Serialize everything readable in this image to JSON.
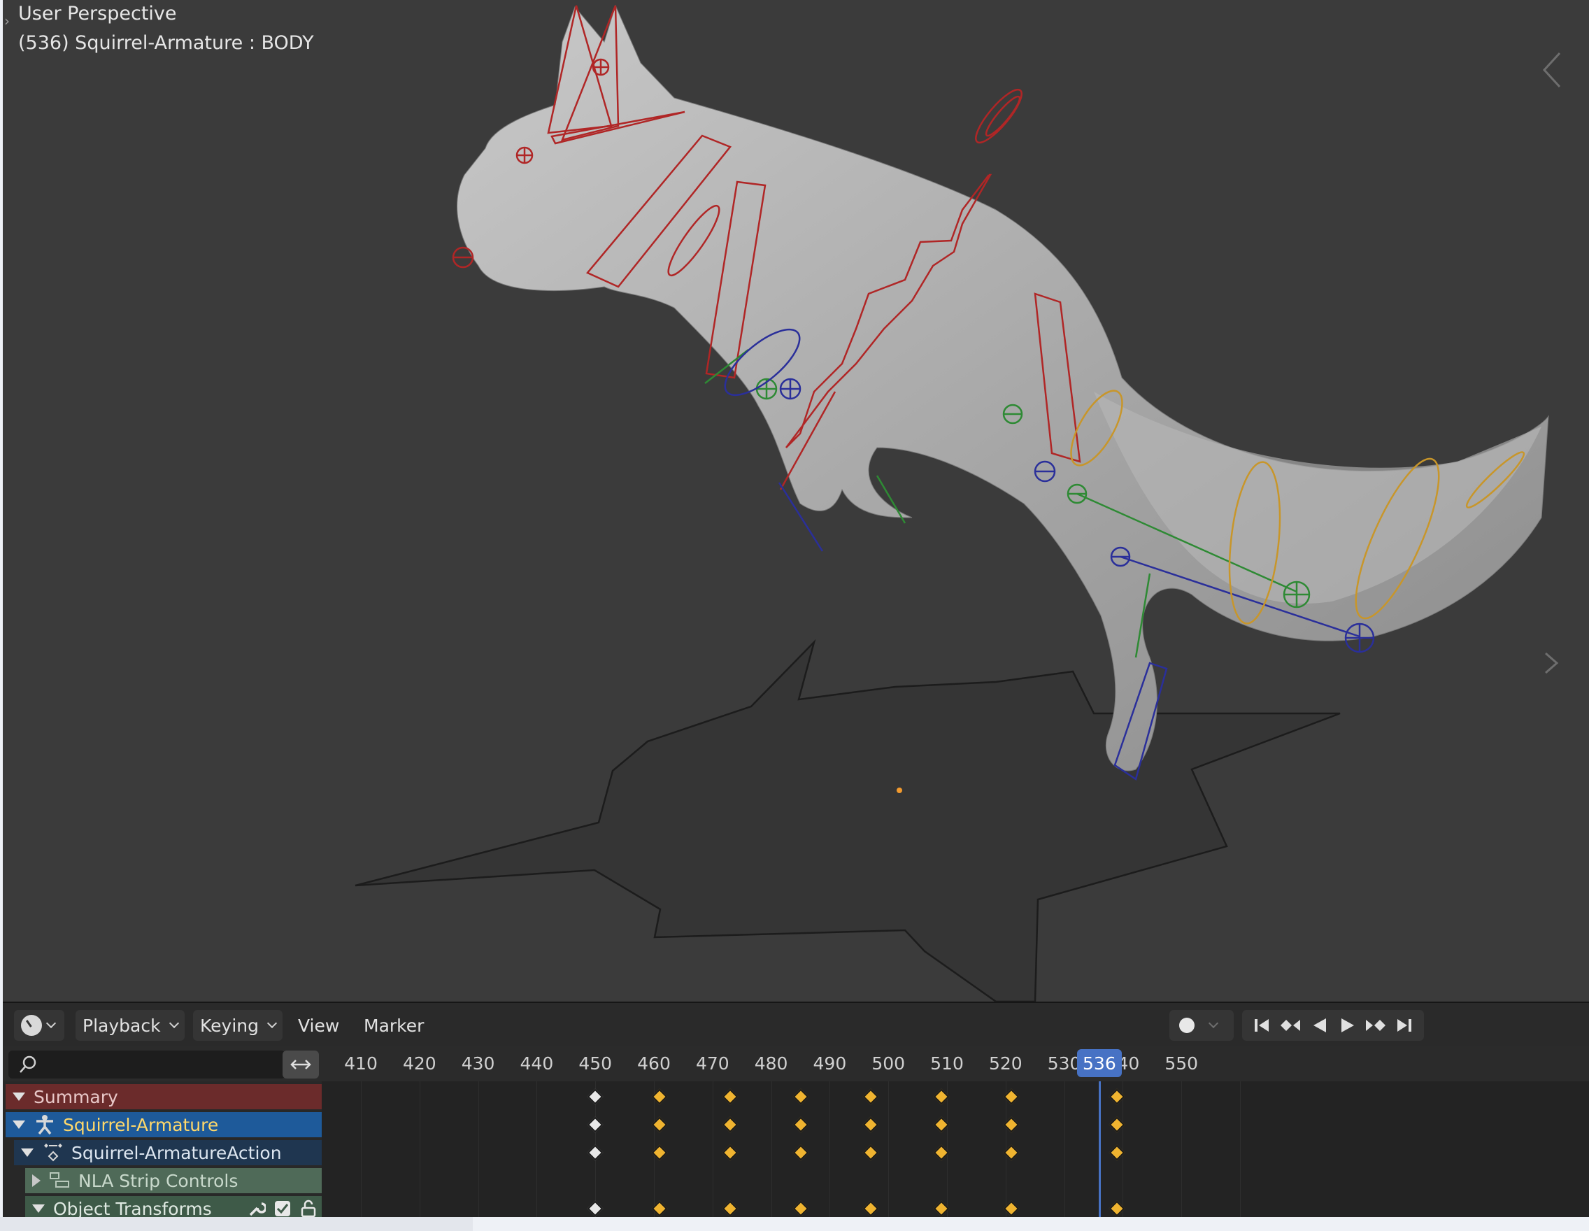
{
  "viewport": {
    "title": "User Perspective",
    "object_info": "(536) Squirrel-Armature : BODY"
  },
  "timeline": {
    "editor_icon": "clock-icon",
    "menus": {
      "playback": "Playback",
      "keying": "Keying",
      "view": "View",
      "marker": "Marker"
    },
    "transport_icons": [
      "jump-start-icon",
      "prev-keyframe-icon",
      "play-reverse-icon",
      "play-icon",
      "next-keyframe-icon",
      "jump-end-icon"
    ],
    "search": {
      "value": "",
      "placeholder": ""
    },
    "ticks": [
      "410",
      "420",
      "430",
      "440",
      "450",
      "460",
      "470",
      "480",
      "490",
      "500",
      "510",
      "520",
      "530",
      "540",
      "550"
    ],
    "current_frame": "536",
    "keyframes": [
      450,
      461,
      473,
      485,
      497,
      509,
      521,
      539
    ],
    "channels": {
      "summary": "Summary",
      "armature": "Squirrel-Armature",
      "action": "Squirrel-ArmatureAction",
      "nla": "NLA Strip Controls",
      "object_transforms": "Object Transforms"
    }
  },
  "colors": {
    "accent": "#4772c4",
    "keyframe": "#f0b430",
    "summary_bg": "#6b2b2b",
    "armature_bg": "#1e5a9a"
  }
}
